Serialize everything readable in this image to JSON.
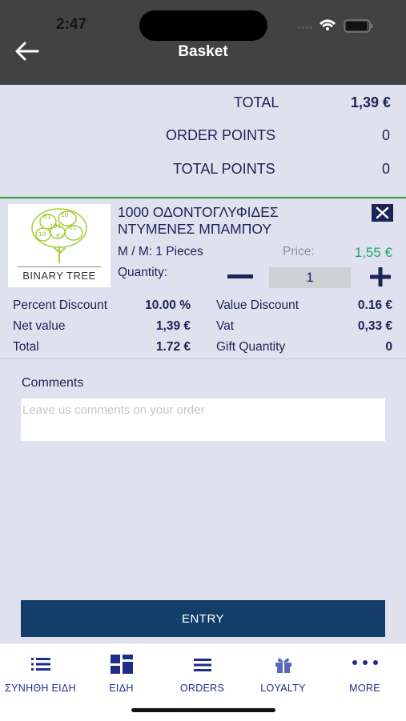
{
  "status_bar": {
    "time": "2:47"
  },
  "header": {
    "title": "Basket"
  },
  "totals": {
    "total_label": "TOTAL",
    "total_value": "1,39 €",
    "order_points_label": "ORDER POINTS",
    "order_points_value": "0",
    "total_points_label": "TOTAL POINTS",
    "total_points_value": "0"
  },
  "product": {
    "brand": "BINARY TREE",
    "name_line1": "1000 ΟΔΟΝΤΟΓΛΥΦΙΔΕΣ",
    "name_line2": "ΝΤΥΜΕΝΕΣ ΜΠΑΜΠΟΥ",
    "mm": "M / M: 1 Pieces",
    "price_label": "Price:",
    "price_value": "1,55 €",
    "quantity_label": "Quantity:",
    "quantity_value": "1"
  },
  "details": {
    "percent_discount_label": "Percent Discount",
    "percent_discount_value": "10.00 %",
    "value_discount_label": "Value Discount",
    "value_discount_value": "0.16 €",
    "net_value_label": "Net value",
    "net_value_value": "1,39 €",
    "vat_label": "Vat",
    "vat_value": "0,33 €",
    "total_label": "Total",
    "total_value": "1.72 €",
    "gift_quantity_label": "Gift Quantity",
    "gift_quantity_value": "0"
  },
  "comments": {
    "label": "Comments",
    "placeholder": "Leave us comments on your order",
    "value": ""
  },
  "entry_button": {
    "label": "ENTRY"
  },
  "tabs": [
    {
      "label": "ΣΥΝΗΘΗ ΕΙΔΗ",
      "icon": "list-icon"
    },
    {
      "label": "ΕΙΔΗ",
      "icon": "grid-icon"
    },
    {
      "label": "ORDERS",
      "icon": "menu-icon"
    },
    {
      "label": "LOYALTY",
      "icon": "gift-icon"
    },
    {
      "label": "MORE",
      "icon": "more-icon"
    }
  ],
  "colors": {
    "header": "#424242",
    "background": "#dfe1ee",
    "text": "#1c2455",
    "price": "#22a66a",
    "divider": "#2e9a3a",
    "entry_button": "#133e6a",
    "tab_label": "#1f2c8a"
  }
}
